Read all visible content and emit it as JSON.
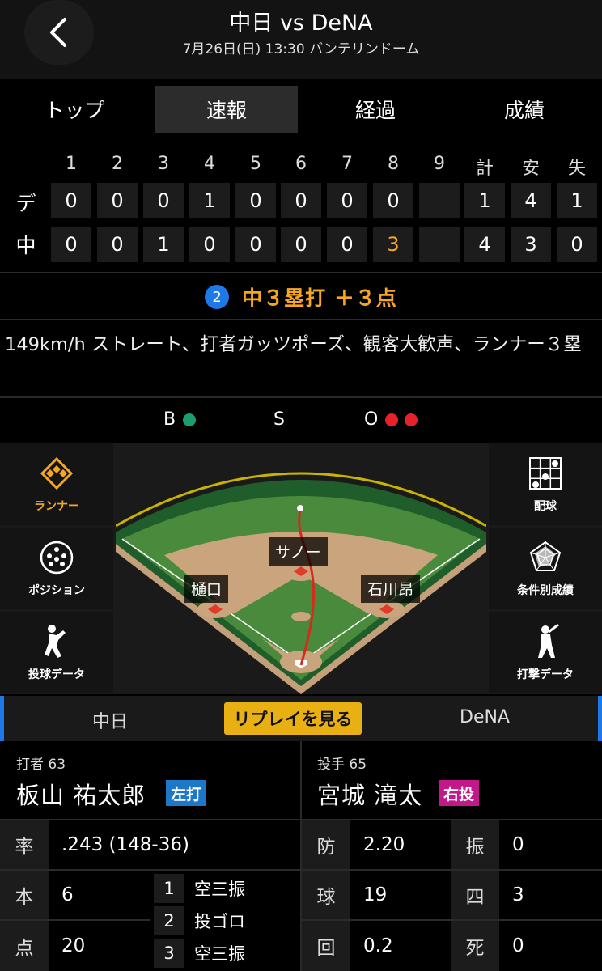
{
  "header": {
    "title": "中日 vs DeNA",
    "subtitle": "7月26日(日) 13:30 バンテリンドーム"
  },
  "tabs": [
    {
      "label": "トップ",
      "active": false
    },
    {
      "label": "速報",
      "active": true
    },
    {
      "label": "経過",
      "active": false
    },
    {
      "label": "成績",
      "active": false
    }
  ],
  "scoreboard": {
    "columns": [
      "1",
      "2",
      "3",
      "4",
      "5",
      "6",
      "7",
      "8",
      "9",
      "計",
      "安",
      "失"
    ],
    "rows": [
      {
        "team": "デ",
        "innings": [
          "0",
          "0",
          "0",
          "1",
          "0",
          "0",
          "0",
          "0",
          ""
        ],
        "totals": [
          "1",
          "4",
          "1"
        ]
      },
      {
        "team": "中",
        "innings": [
          "0",
          "0",
          "1",
          "0",
          "0",
          "0",
          "0",
          "3",
          ""
        ],
        "totals": [
          "4",
          "3",
          "0"
        ]
      }
    ],
    "highlight_color": "#f5a623"
  },
  "play": {
    "outs_badge": "2",
    "headline": "中３塁打 ＋３点",
    "description": "149km/h ストレート、打者ガッツポーズ、観客大歓声、ランナー３塁"
  },
  "count": {
    "ball_label": "B",
    "strike_label": "S",
    "out_label": "O",
    "balls": 1,
    "strikes": 0,
    "outs": 2,
    "ball_color": "#1a9e6e",
    "out_color": "#e8202a"
  },
  "side_buttons_left": [
    {
      "label": "ランナー",
      "icon": "runner-diamond-icon",
      "active": true
    },
    {
      "label": "ポジション",
      "icon": "position-icon",
      "active": false
    },
    {
      "label": "投球データ",
      "icon": "pitcher-icon",
      "active": false
    }
  ],
  "side_buttons_right": [
    {
      "label": "配球",
      "icon": "pitch-grid-icon",
      "active": false
    },
    {
      "label": "条件別成績",
      "icon": "radar-chart-icon",
      "active": false
    },
    {
      "label": "打撃データ",
      "icon": "batter-icon",
      "active": false
    }
  ],
  "field": {
    "players": {
      "second": "サノー",
      "third": "樋口",
      "first": "石川昂"
    },
    "runner_on_third": false
  },
  "replay": {
    "left_team": "中日",
    "button_label": "リプレイを見る",
    "right_team": "DeNA"
  },
  "batter": {
    "role": "打者 63",
    "name": "板山 祐太郎",
    "badge": "左打",
    "badge_color": "#1e78c8",
    "stats": [
      {
        "label": "率",
        "value": ".243 (148-36)"
      },
      {
        "label": "本",
        "value": "6"
      },
      {
        "label": "点",
        "value": "20"
      }
    ],
    "at_bats": [
      {
        "no": "1",
        "result": "空三振"
      },
      {
        "no": "2",
        "result": "投ゴロ"
      },
      {
        "no": "3",
        "result": "空三振"
      }
    ]
  },
  "pitcher": {
    "role": "投手 65",
    "name": "宮城 滝太",
    "badge": "右投",
    "badge_color": "#c2188a",
    "stats": [
      {
        "label": "防",
        "value": "2.20"
      },
      {
        "label": "球",
        "value": "19"
      },
      {
        "label": "回",
        "value": "0.2"
      }
    ],
    "stats2": [
      {
        "label": "振",
        "value": "0"
      },
      {
        "label": "四",
        "value": "3"
      },
      {
        "label": "死",
        "value": "0"
      }
    ]
  }
}
